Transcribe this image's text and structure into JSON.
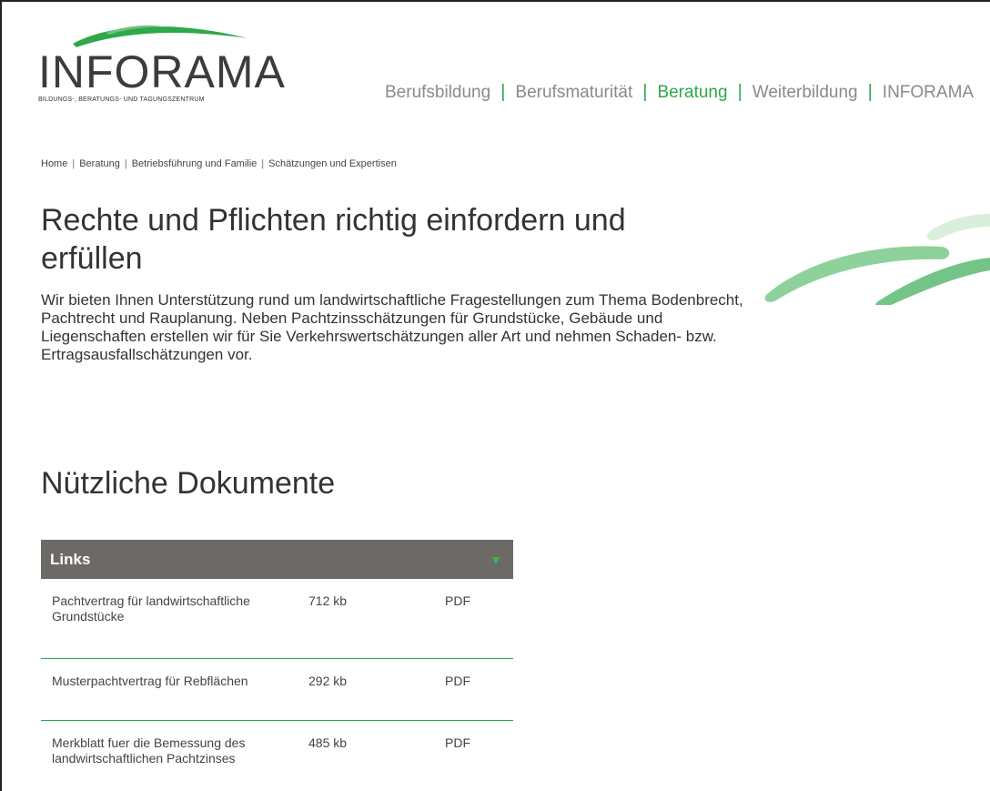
{
  "brand": {
    "name": "INFORAMA",
    "tagline": "BILDUNGS-, BERATUNGS- UND TAGUNGSZENTRUM",
    "accent": "#2ea84a"
  },
  "nav": {
    "items": [
      {
        "label": "Berufsbildung"
      },
      {
        "label": "Berufsmaturität"
      },
      {
        "label": "Beratung",
        "active": true
      },
      {
        "label": "Weiterbildung"
      },
      {
        "label": "INFORAMA"
      }
    ]
  },
  "breadcrumb": [
    "Home",
    "Beratung",
    "Betriebsführung und Familie",
    "Schätzungen und Expertisen"
  ],
  "page": {
    "title": "Rechte und Pflichten richtig einfordern und erfüllen",
    "intro": "Wir bieten Ihnen Unterstützung rund um landwirtschaftliche Fragestellungen zum Thema Bodenbrecht, Pachtrecht und Rauplanung. Neben Pachtzinsschätzungen für Grundstücke, Gebäude und Liegenschaften erstellen wir für Sie Verkehrswertschätzungen aller Art und nehmen Schaden- bzw. Ertragsausfallschätzungen vor.",
    "docs_title": "Nützliche Dokumente"
  },
  "links": {
    "header": "Links",
    "header_color": "#6d6966",
    "toggle_icon": "triangle-down-icon",
    "rows": [
      {
        "name": "Pachtvertrag für landwirtschaftliche Grundstücke",
        "size": "712 kb",
        "type": "PDF"
      },
      {
        "name": "Musterpachtvertrag für Rebflächen",
        "size": "292 kb",
        "type": "PDF"
      },
      {
        "name": "Merkblatt fuer die Bemessung des landwirtschaftlichen Pachtzinses",
        "size": "485 kb",
        "type": "PDF"
      }
    ]
  }
}
